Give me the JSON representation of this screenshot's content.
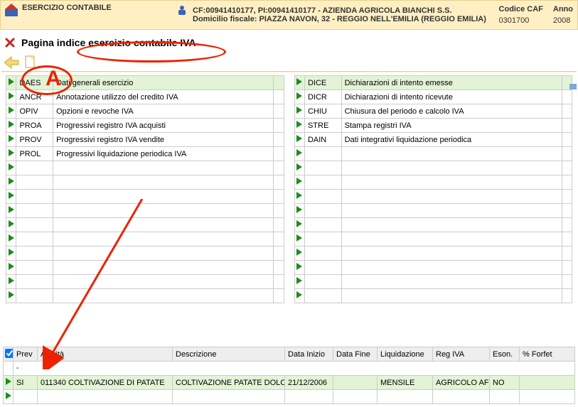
{
  "header": {
    "title": "ESERCIZIO CONTABILE",
    "line1": "CF:00941410177, PI:00941410177 - AZIENDA AGRICOLA BIANCHI S.S.",
    "line2": "Domicilio fiscale: PIAZZA NAVON, 32 - REGGIO NELL'EMILIA (REGGIO EMILIA)",
    "codice_caf_label": "Codice CAF",
    "codice_caf_value": "0301700",
    "anno_label": "Anno",
    "anno_value": "2008"
  },
  "page_title": "Pagina indice esercizio contabile IVA",
  "left_menu": [
    {
      "code": "DAES",
      "desc": "Dati generali esercizio"
    },
    {
      "code": "ANCR",
      "desc": "Annotazione utilizzo del credito IVA"
    },
    {
      "code": "OPIV",
      "desc": "Opzioni e revoche IVA"
    },
    {
      "code": "PROA",
      "desc": "Progressivi registro IVA acquisti"
    },
    {
      "code": "PROV",
      "desc": "Progressivi registro IVA vendite"
    },
    {
      "code": "PROL",
      "desc": "Progressivi liquidazione periodica IVA"
    }
  ],
  "right_menu": [
    {
      "code": "DICE",
      "desc": "Dichiarazioni di intento emesse"
    },
    {
      "code": "DICR",
      "desc": "Dichiarazioni di intento ricevute"
    },
    {
      "code": "CHIU",
      "desc": "Chiusura del periodo e calcolo IVA"
    },
    {
      "code": "STRE",
      "desc": "Stampa registri IVA"
    },
    {
      "code": "DAIN",
      "desc": "Dati integrativi liquidazione periodica"
    }
  ],
  "bottom": {
    "cols": {
      "prev": "Prev",
      "attivita": "Attività",
      "descrizione": "Descrizione",
      "data_inizio": "Data Inizio",
      "data_fine": "Data Fine",
      "liquidazione": "Liquidazione",
      "reg_iva": "Reg IVA",
      "eson": "Eson.",
      "forfet": "% Forfet"
    },
    "rows": [
      {
        "prev": "SI",
        "attivita": "011340 COLTIVAZIONE DI PATATE",
        "descrizione": "COLTIVAZIONE PATATE DOLCI E A",
        "data_inizio": "21/12/2006",
        "data_fine": "",
        "liquidazione": "MENSILE",
        "reg_iva": "AGRICOLO AF",
        "eson": "NO",
        "forfet": ""
      }
    ]
  },
  "annotations": {
    "circle_label": "A"
  }
}
